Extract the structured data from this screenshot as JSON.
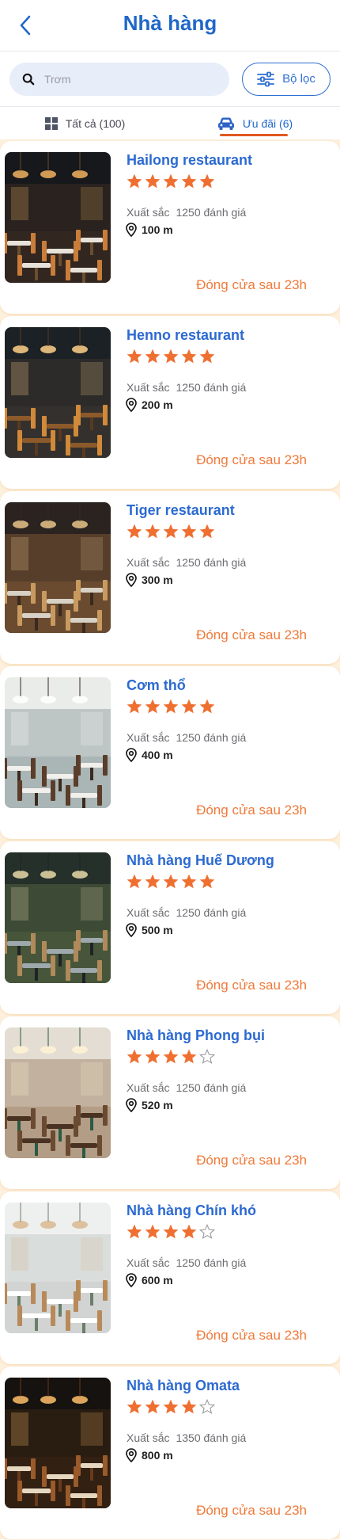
{
  "header": {
    "title": "Nhà hàng"
  },
  "search": {
    "placeholder": "Trơm"
  },
  "filter": {
    "label": "Bộ lọc"
  },
  "tabs": {
    "all": "Tất cả (100)",
    "offers": "Ưu đãi (6)"
  },
  "colors": {
    "accent": "#2067c9",
    "star": "#ef6f31",
    "status": "#ef7a3a",
    "list_bg": "#fdf0dd"
  },
  "restaurants": [
    {
      "name": "Hailong restaurant",
      "stars": 5,
      "rating_word": "Xuất sắc",
      "reviews": "1250 đánh giá",
      "distance": "100 m",
      "status": "Đóng cửa sau 23h",
      "photo_theme": "dark-dining"
    },
    {
      "name": "Henno restaurant",
      "stars": 5,
      "rating_word": "Xuất sắc",
      "reviews": "1250 đánh giá",
      "distance": "200 m",
      "status": "Đóng cửa sau 23h",
      "photo_theme": "loft-bar"
    },
    {
      "name": "Tiger restaurant",
      "stars": 5,
      "rating_word": "Xuất sắc",
      "reviews": "1250 đánh giá",
      "distance": "300 m",
      "status": "Đóng cửa sau 23h",
      "photo_theme": "tiled-hall"
    },
    {
      "name": "Cơm thổ",
      "stars": 5,
      "rating_word": "Xuất sắc",
      "reviews": "1250 đánh giá",
      "distance": "400 m",
      "status": "Đóng cửa sau 23h",
      "photo_theme": "window-view"
    },
    {
      "name": "Nhà hàng Huế Dương",
      "stars": 5,
      "rating_word": "Xuất sắc",
      "reviews": "1250 đánh giá",
      "distance": "500 m",
      "status": "Đóng cửa sau 23h",
      "photo_theme": "patio"
    },
    {
      "name": "Nhà hàng Phong bụi",
      "stars": 4,
      "rating_word": "Xuất sắc",
      "reviews": "1250 đánh giá",
      "distance": "520 m",
      "status": "Đóng cửa sau 23h",
      "photo_theme": "bistro"
    },
    {
      "name": "Nhà hàng Chín khó",
      "stars": 4,
      "rating_word": "Xuất sắc",
      "reviews": "1250 đánh giá",
      "distance": "600 m",
      "status": "Đóng cửa sau 23h",
      "photo_theme": "white-lamps"
    },
    {
      "name": "Nhà hàng Omata",
      "stars": 4,
      "rating_word": "Xuất sắc",
      "reviews": "1350 đánh giá",
      "distance": "800 m",
      "status": "Đóng cửa sau 23h",
      "photo_theme": "banquet"
    }
  ]
}
